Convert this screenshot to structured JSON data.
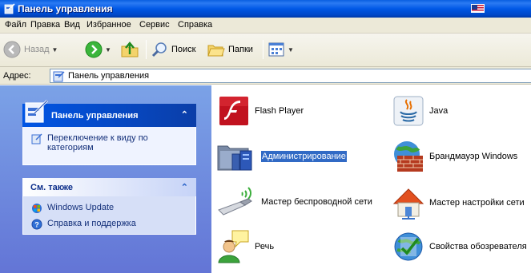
{
  "window": {
    "title": "Панель управления"
  },
  "menu": [
    "Файл",
    "Правка",
    "Вид",
    "Избранное",
    "Сервис",
    "Справка"
  ],
  "toolbar": {
    "back_label": "Назад",
    "search_label": "Поиск",
    "folders_label": "Папки"
  },
  "address": {
    "label": "Адрес:",
    "value": "Панель управления"
  },
  "sidebar": {
    "panel_title": "Панель управления",
    "switch_view_label": "Переключение к виду по категориям",
    "see_also_title": "См. также",
    "links": [
      "Windows Update",
      "Справка и поддержка"
    ]
  },
  "items": [
    {
      "label": "Flash Player",
      "icon": "flash-icon"
    },
    {
      "label": "Java",
      "icon": "java-icon"
    },
    {
      "label": "Администрирование",
      "icon": "admin-tools-icon",
      "selected": true
    },
    {
      "label": "Брандмауэр Windows",
      "icon": "firewall-icon"
    },
    {
      "label": "Мастер беспроводной сети",
      "icon": "wireless-icon"
    },
    {
      "label": "Мастер настройки сети",
      "icon": "network-setup-icon"
    },
    {
      "label": "Речь",
      "icon": "speech-icon"
    },
    {
      "label": "Свойства обозревателя",
      "icon": "internet-options-icon"
    }
  ],
  "colors": {
    "titlebar": "#0058e6",
    "selection": "#316ac5",
    "sidebar": "#7ba2e7"
  }
}
